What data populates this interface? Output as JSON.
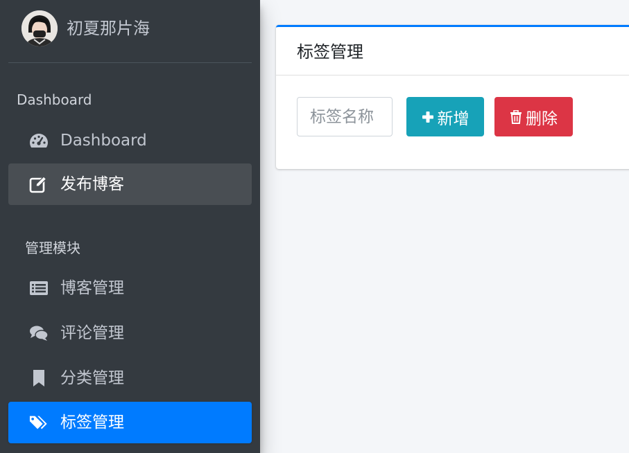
{
  "brand": {
    "name": "初夏那片海",
    "avatar_icon": "user-avatar"
  },
  "sidebar": {
    "header_dashboard": "Dashboard",
    "items_top": [
      {
        "label": "Dashboard",
        "icon": "tachometer-icon"
      },
      {
        "label": "发布博客",
        "icon": "edit-icon",
        "state": "hover"
      }
    ],
    "header_manage": "管理模块",
    "items_manage": [
      {
        "label": "博客管理",
        "icon": "list-icon"
      },
      {
        "label": "评论管理",
        "icon": "comments-icon"
      },
      {
        "label": "分类管理",
        "icon": "bookmark-icon"
      },
      {
        "label": "标签管理",
        "icon": "tags-icon",
        "state": "active"
      }
    ]
  },
  "card": {
    "title": "标签管理",
    "search_placeholder": "标签名称",
    "add_label": "新增",
    "delete_label": "删除"
  },
  "colors": {
    "sidebar_bg": "#343a40",
    "primary": "#007bff",
    "info": "#17a2b8",
    "danger": "#dc3545",
    "sidebar_text": "#c2c7d0"
  }
}
